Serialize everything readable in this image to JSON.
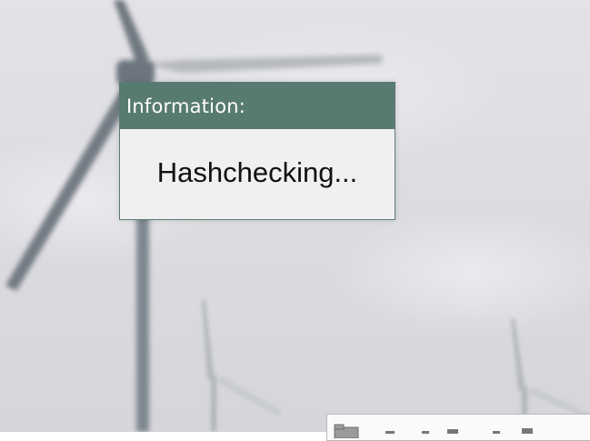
{
  "desktop": {
    "wallpaper_icon": "wind-turbine-wallpaper"
  },
  "info_dialog": {
    "title": "Information:",
    "message": "Hashchecking...",
    "titlebar_color": "#587b71",
    "body_color": "#f0f0f0"
  },
  "partial_window": {
    "icon": "folder-icon"
  }
}
